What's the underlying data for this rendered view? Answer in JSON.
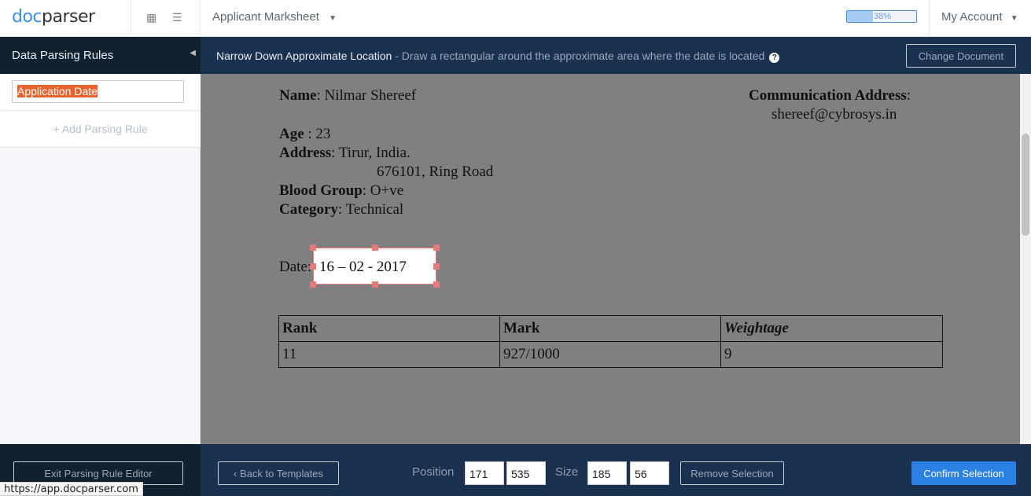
{
  "topbar": {
    "logo_a": "doc",
    "logo_b": "parser",
    "template": "Applicant Marksheet",
    "progress_percent": 38,
    "progress_label": "38%",
    "account": "My Account"
  },
  "sidebar": {
    "title": "Data Parsing Rules",
    "rule_value": "Application Date",
    "add_rule": "+ Add Parsing Rule",
    "exit": "Exit Parsing Rule Editor"
  },
  "main": {
    "title": "Narrow Down Approximate Location",
    "subtitle": " - Draw a rectangular around the approximate area where the date is located",
    "change_doc": "Change Document"
  },
  "document": {
    "name_label": "Name",
    "name": ": Nilmar Shereef",
    "comm_label": "Communication Address",
    "comm_colon": ":",
    "email": "shereef@cybrosys.in",
    "age_label": "Age",
    "age": " : 23",
    "addr_label": "Address",
    "addr1": ": Tirur, India.",
    "addr2": "676101, Ring Road",
    "blood_label": "Blood Group",
    "blood": ": O+ve",
    "cat_label": "Category",
    "cat": ": Technical",
    "date_label": "Date:",
    "date": "16 – 02 - 2017",
    "table": {
      "headers": [
        "Rank",
        "Mark",
        "Weightage"
      ],
      "row": [
        "11",
        "927/1000",
        "9"
      ]
    }
  },
  "footer": {
    "back": "Back to Templates",
    "position_label": "Position",
    "pos_x": "171",
    "pos_y": "535",
    "size_label": "Size",
    "size_w": "185",
    "size_h": "56",
    "remove": "Remove Selection",
    "confirm": "Confirm Selection"
  },
  "status_url": "https://app.docparser.com"
}
